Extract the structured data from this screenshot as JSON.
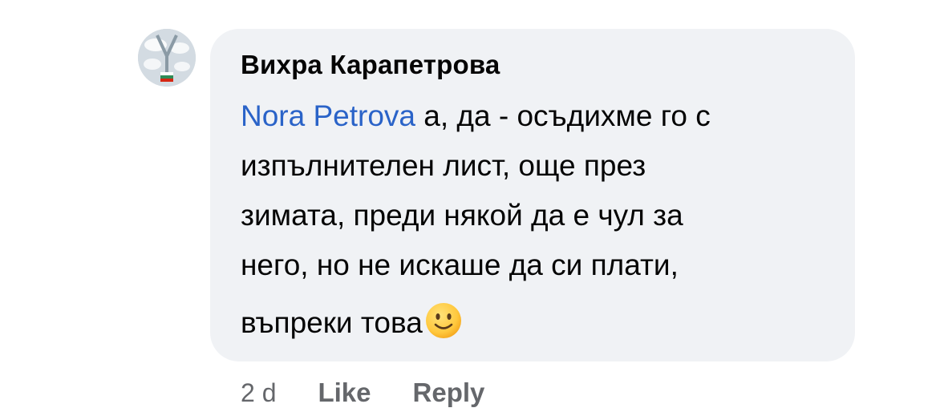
{
  "comment": {
    "author": "Вихра Карапетрова",
    "mention": "Nora Petrova",
    "lines": [
      " а, да - осъдихме го с",
      "изпълнителен лист, още през",
      "зимата, преди някой да е чул за",
      "него, но не искаше да си плати,",
      "въпреки това"
    ],
    "emoji_icon": "slightly-smiling-face",
    "timestamp": "2 d",
    "like_label": "Like",
    "reply_label": "Reply"
  },
  "colors": {
    "bubble_bg": "#f0f2f5",
    "mention": "#2a63c8",
    "text": "#050505",
    "meta": "#65676b"
  }
}
